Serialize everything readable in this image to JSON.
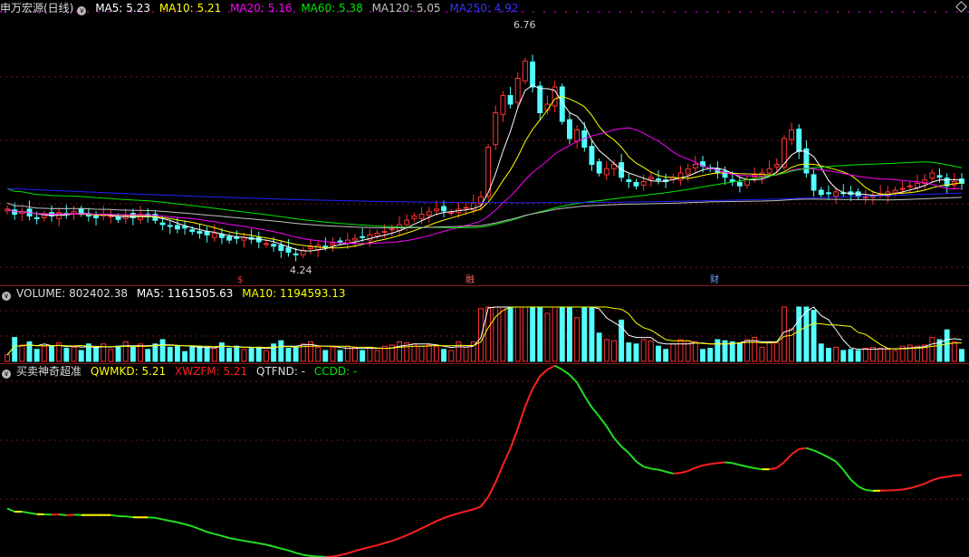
{
  "header1": {
    "title": "申万宏源(日线)",
    "ma5": "MA5: 5.23",
    "ma10": "MA10: 5.21",
    "ma20": "MA20: 5.16",
    "ma60": "MA60: 5.38",
    "ma120": "MA120: 5.05",
    "ma250": "MA250: 4.92"
  },
  "header2": {
    "volume": "VOLUME: 802402.38",
    "ma5": "MA5: 1161505.63",
    "ma10": "MA10: 1194593.13"
  },
  "header3": {
    "title": "买卖神奇超准",
    "qwmkd": "QWMKD: 5.21",
    "xwzfm": "XWZFM: 5.21",
    "qtfnd": "QTFND: -",
    "ccdd": "CCDD: -"
  },
  "colors": {
    "up": "#ff3232",
    "down": "#54ffff",
    "ma5": "#ffffff",
    "ma10": "#ffff00",
    "ma20": "#ff00ff",
    "ma60": "#00e600",
    "ma120": "#c0c0c0",
    "ma250": "#2222ff"
  },
  "chart_data": [
    {
      "type": "candlestick",
      "annotations": {
        "high": "6.76",
        "low": "4.24"
      },
      "markers": [
        "$",
        "融",
        "财"
      ],
      "ylim": [
        4.0,
        7.0
      ],
      "closes": [
        4.78,
        4.72,
        4.75,
        4.7,
        4.68,
        4.72,
        4.7,
        4.74,
        4.72,
        4.75,
        4.73,
        4.7,
        4.68,
        4.72,
        4.7,
        4.66,
        4.7,
        4.68,
        4.72,
        4.7,
        4.65,
        4.6,
        4.58,
        4.55,
        4.56,
        4.52,
        4.5,
        4.48,
        4.5,
        4.45,
        4.42,
        4.44,
        4.45,
        4.43,
        4.4,
        4.38,
        4.35,
        4.3,
        4.28,
        4.25,
        4.3,
        4.34,
        4.36,
        4.35,
        4.38,
        4.4,
        4.42,
        4.44,
        4.45,
        4.48,
        4.5,
        4.52,
        4.55,
        4.6,
        4.65,
        4.7,
        4.72,
        4.75,
        4.78,
        4.76,
        4.74,
        4.78,
        4.8,
        4.85,
        4.92,
        5.5,
        5.9,
        6.1,
        6.0,
        6.3,
        6.5,
        6.2,
        5.9,
        6.0,
        6.2,
        5.8,
        5.6,
        5.7,
        5.5,
        5.3,
        5.2,
        5.25,
        5.3,
        5.15,
        5.1,
        5.05,
        5.1,
        5.15,
        5.12,
        5.1,
        5.15,
        5.2,
        5.25,
        5.3,
        5.28,
        5.25,
        5.2,
        5.15,
        5.1,
        5.05,
        5.12,
        5.18,
        5.2,
        5.25,
        5.3,
        5.6,
        5.7,
        5.45,
        5.2,
        5.0,
        4.95,
        4.96,
        4.98,
        4.97,
        4.95,
        4.93,
        4.92,
        4.94,
        4.96,
        4.98,
        5.0,
        5.02,
        5.05,
        5.08,
        5.12,
        5.2,
        5.15,
        5.05,
        5.1,
        5.08
      ]
    },
    {
      "type": "bar",
      "name": "volume"
    },
    {
      "type": "line",
      "name": "QWMKD"
    }
  ]
}
